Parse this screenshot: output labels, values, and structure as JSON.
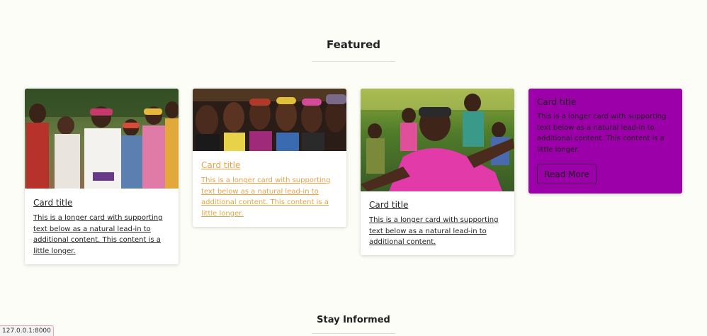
{
  "featured": {
    "title": "Featured",
    "cards": [
      {
        "image": "women-dancing-photo",
        "title": "Card title",
        "text": "This is a longer card with supporting text below as a natural lead-in to additional content. This content is a little longer."
      },
      {
        "image": "women-smiling-photo",
        "title": "Card title",
        "text": "This is a longer card with supporting text below as a natural lead-in to additional content. This content is a little longer.",
        "text_color": "#e8a347"
      },
      {
        "image": "woman-singing-photo",
        "title": "Card title",
        "text": "This is a longer card with supporting text below as a natural lead-in to additional content."
      },
      {
        "title": "Card title",
        "text": "This is a longer card with supporting text below as a natural lead-in to additional content. This content is a little longer.",
        "button_label": "Read More",
        "background": "#9c00a8"
      }
    ]
  },
  "stay_informed": {
    "title": "Stay Informed"
  },
  "status_bar": {
    "url": "127.0.0.1:8000"
  }
}
